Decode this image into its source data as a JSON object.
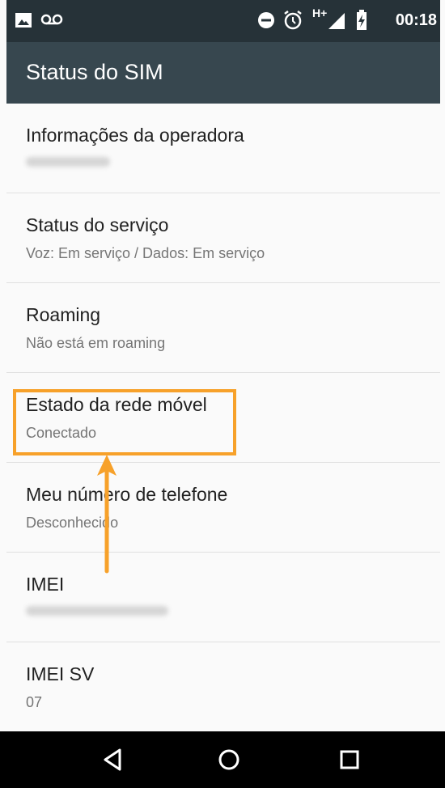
{
  "status_bar": {
    "time": "00:18",
    "icons": [
      "image-icon",
      "voicemail-icon",
      "do-not-disturb-icon",
      "alarm-icon",
      "hplus-data-icon",
      "signal-icon",
      "battery-charging-icon"
    ],
    "network_type": "H+"
  },
  "app_bar": {
    "title": "Status do SIM"
  },
  "items": [
    {
      "title": "Informações da operadora",
      "subtitle": ""
    },
    {
      "title": "Status do serviço",
      "subtitle": "Voz: Em serviço / Dados: Em serviço"
    },
    {
      "title": "Roaming",
      "subtitle": "Não está em roaming"
    },
    {
      "title": "Estado da rede móvel",
      "subtitle": "Conectado"
    },
    {
      "title": "Meu número de telefone",
      "subtitle": "Desconhecido"
    },
    {
      "title": "IMEI",
      "subtitle": ""
    },
    {
      "title": "IMEI SV",
      "subtitle": "07"
    }
  ],
  "nav_bar": {
    "buttons": [
      "back-icon",
      "home-icon",
      "recents-icon"
    ]
  },
  "colors": {
    "status_bar": "#263238",
    "app_bar": "#37474f",
    "highlight": "#f7a12a",
    "background": "#fafafa"
  }
}
